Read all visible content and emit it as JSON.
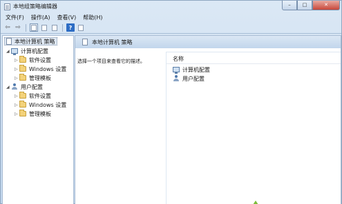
{
  "window": {
    "title": "本地组策略编辑器"
  },
  "window_controls": {
    "minimize": "–",
    "maximize": "□",
    "close": "✕"
  },
  "menu": [
    "文件(F)",
    "操作(A)",
    "查看(V)",
    "帮助(H)"
  ],
  "toolbar": {
    "back_icon": "back-arrow-icon",
    "forward_icon": "forward-arrow-icon",
    "help_label": "?"
  },
  "tree": {
    "root": "本地计算机 策略",
    "computer_config": {
      "label": "计算机配置",
      "children": [
        "软件设置",
        "Windows 设置",
        "管理模板"
      ]
    },
    "user_config": {
      "label": "用户配置",
      "children": [
        "软件设置",
        "Windows 设置",
        "管理模板"
      ]
    }
  },
  "content": {
    "header": "本地计算机 策略",
    "description": "选择一个项目来查看它的描述。",
    "column_name": "名称",
    "items": [
      "计算机配置",
      "用户配置"
    ]
  }
}
